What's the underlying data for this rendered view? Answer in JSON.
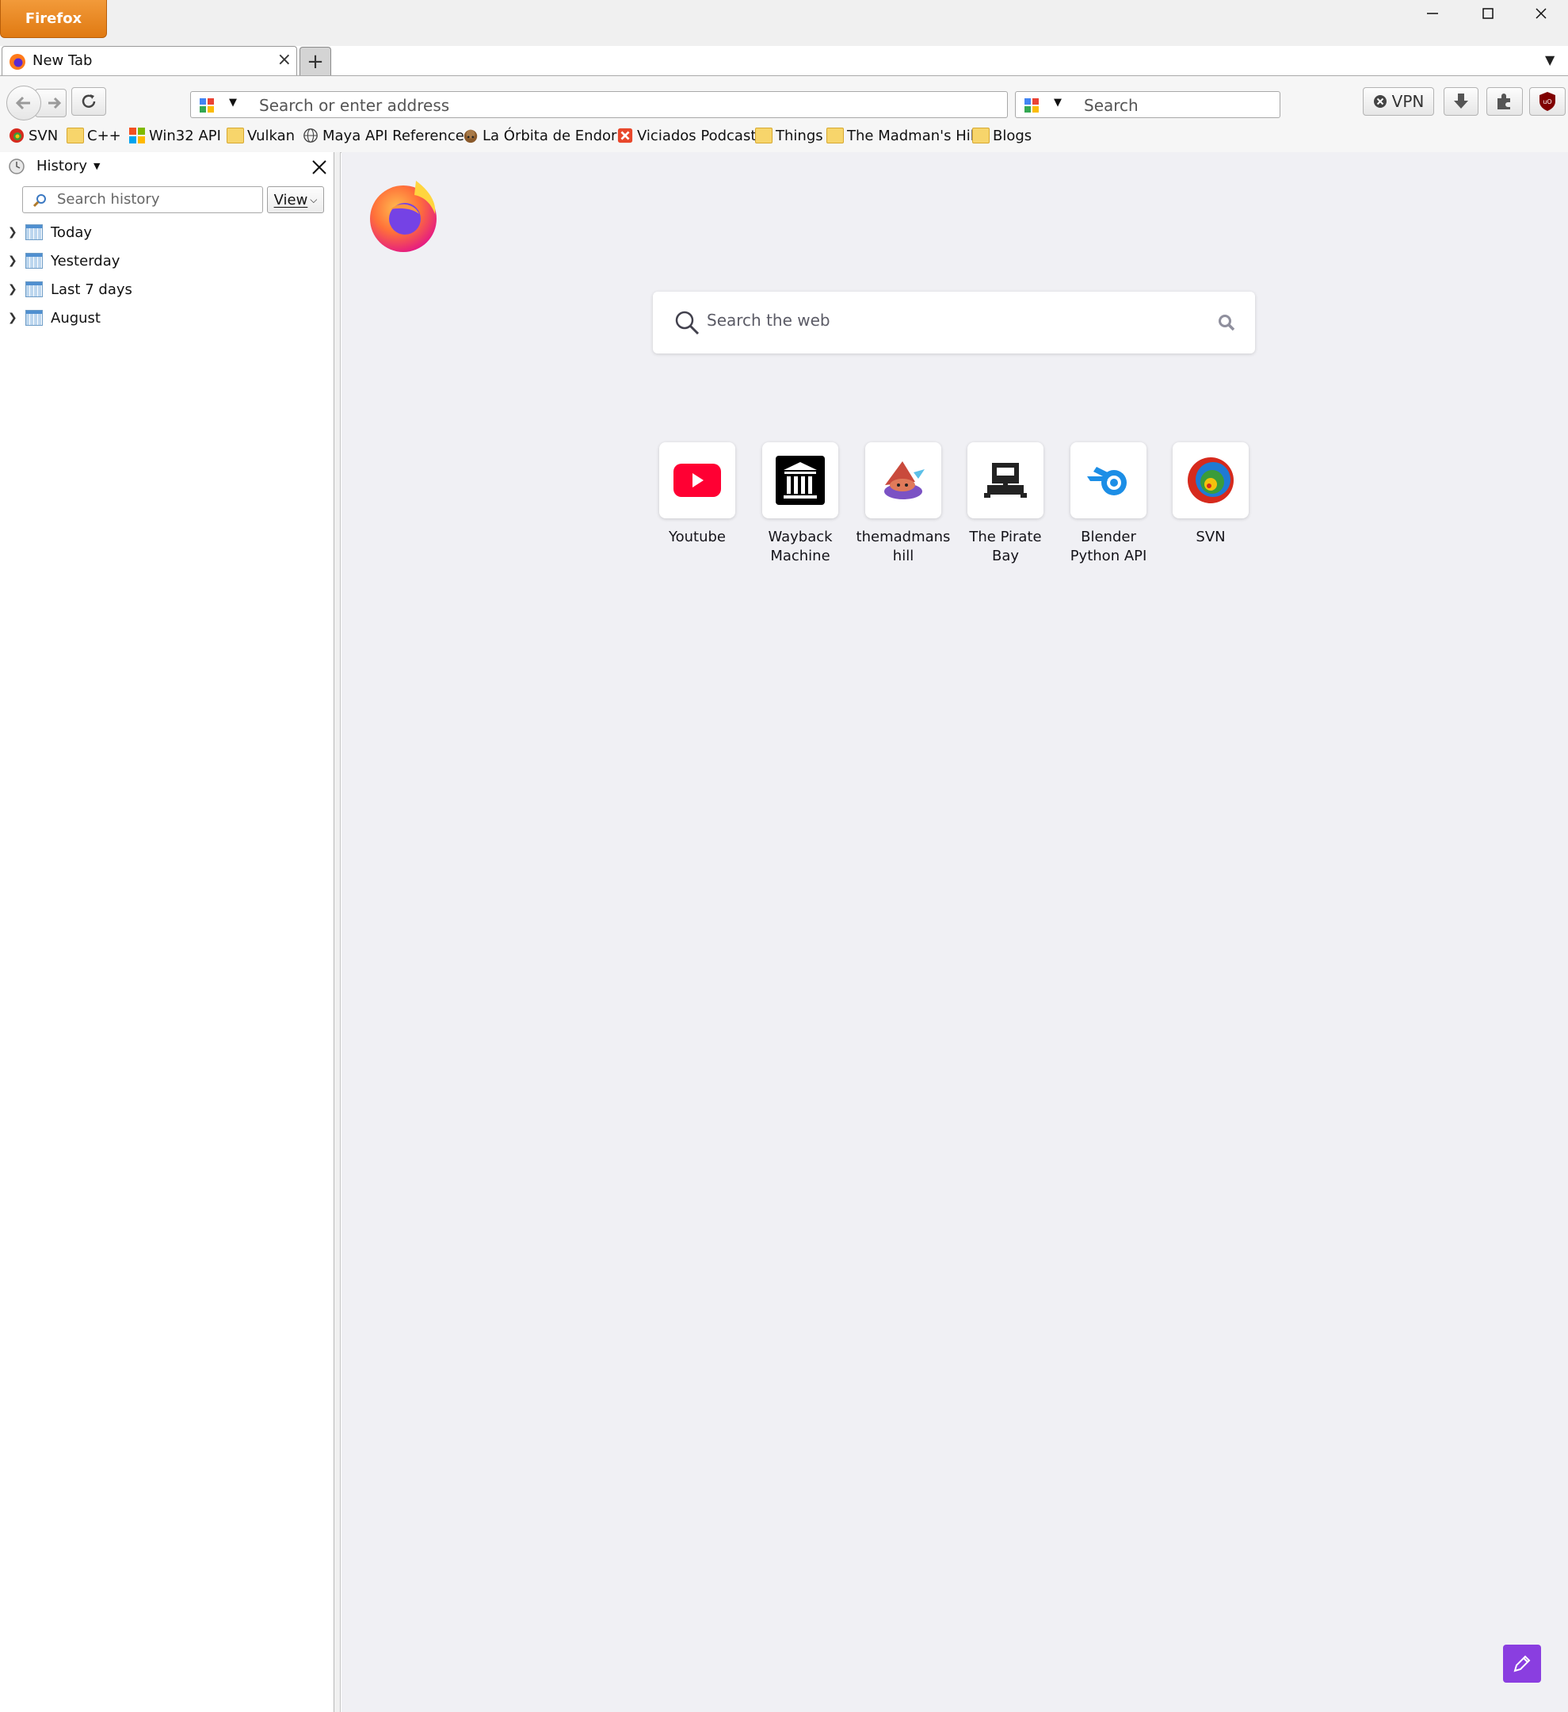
{
  "app": {
    "menu_button": "Firefox"
  },
  "colors": {
    "accent_orange": "#e07a12",
    "edit_button": "#8a3ee0",
    "content_bg": "#f0f0f4"
  },
  "tab": {
    "title": "New Tab",
    "close": "×",
    "new_tab": "+"
  },
  "toolbar": {
    "address_placeholder": "Search or enter address",
    "search_placeholder": "Search",
    "vpn_label": "VPN"
  },
  "bookmarks": [
    {
      "label": "SVN",
      "icon": "svn-icon"
    },
    {
      "label": "C++",
      "icon": "folder-icon"
    },
    {
      "label": "Win32 API",
      "icon": "windows-icon"
    },
    {
      "label": "Vulkan",
      "icon": "folder-icon"
    },
    {
      "label": "Maya API Reference",
      "icon": "globe-icon"
    },
    {
      "label": "La Órbita de Endor",
      "icon": "podcast-icon"
    },
    {
      "label": "Viciados Podcast",
      "icon": "podcast-icon"
    },
    {
      "label": "Things",
      "icon": "folder-icon"
    },
    {
      "label": "The Madman's Hill",
      "icon": "folder-icon"
    },
    {
      "label": "Blogs",
      "icon": "folder-icon"
    }
  ],
  "sidebar": {
    "title": "History",
    "search_placeholder": "Search history",
    "view_label": "View",
    "items": [
      {
        "label": "Today"
      },
      {
        "label": "Yesterday"
      },
      {
        "label": "Last 7 days"
      },
      {
        "label": "August"
      }
    ]
  },
  "newtab": {
    "search_placeholder": "Search the web",
    "top_sites": [
      {
        "line1": "Youtube",
        "line2": "",
        "icon": "youtube-icon"
      },
      {
        "line1": "Wayback",
        "line2": "Machine",
        "icon": "wayback-icon"
      },
      {
        "line1": "themadmans",
        "line2": "hill",
        "icon": "wizard-icon"
      },
      {
        "line1": "The Pirate Bay",
        "line2": "",
        "icon": "pirate-ship-icon"
      },
      {
        "line1": "Blender",
        "line2": "Python API",
        "icon": "blender-icon"
      },
      {
        "line1": "SVN",
        "line2": "",
        "icon": "svn-icon"
      }
    ]
  }
}
